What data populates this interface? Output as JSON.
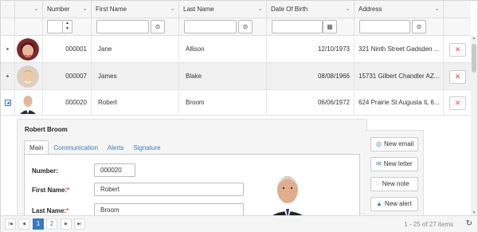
{
  "columns": {
    "number": "Number",
    "first_name": "First Name",
    "last_name": "Last Name",
    "dob": "Date Of Birth",
    "address": "Address"
  },
  "rows": [
    {
      "number": "000001",
      "first_name": "Jane",
      "last_name": "Allison",
      "dob": "12/10/1973",
      "address": "321 Ninth Street Gadsden ..."
    },
    {
      "number": "000007",
      "first_name": "James",
      "last_name": "Blake",
      "dob": "08/08/1966",
      "address": "15731 Gilbert Chandler AZ..."
    },
    {
      "number": "000020",
      "first_name": "Robert",
      "last_name": "Broom",
      "dob": "06/06/1972",
      "address": "624 Prairie St Augusta IL 6..."
    }
  ],
  "detail": {
    "title": "Robert Broom",
    "tabs": [
      "Main",
      "Communication",
      "Alerts",
      "Signature"
    ],
    "labels": {
      "number": "Number:",
      "first_name": "First Name:",
      "last_name": "Last Name:",
      "required": "*"
    },
    "values": {
      "number": "000020",
      "first_name": "Robert",
      "last_name": "Broom"
    },
    "actions": [
      "New email",
      "New letter",
      "New note",
      "New alert"
    ]
  },
  "pager": {
    "pages": [
      "1",
      "2"
    ],
    "current": "1",
    "info": "1 - 25 of 27 items"
  },
  "colors": {
    "accent": "#3c79bd",
    "delete": "#d9534f"
  },
  "icons": [
    "expand-arrow-icon",
    "collapse-icon",
    "filter-icon",
    "calendar-icon",
    "spinner-icon",
    "delete-icon",
    "email-icon",
    "letter-icon",
    "note-icon",
    "alert-icon",
    "refresh-icon"
  ]
}
